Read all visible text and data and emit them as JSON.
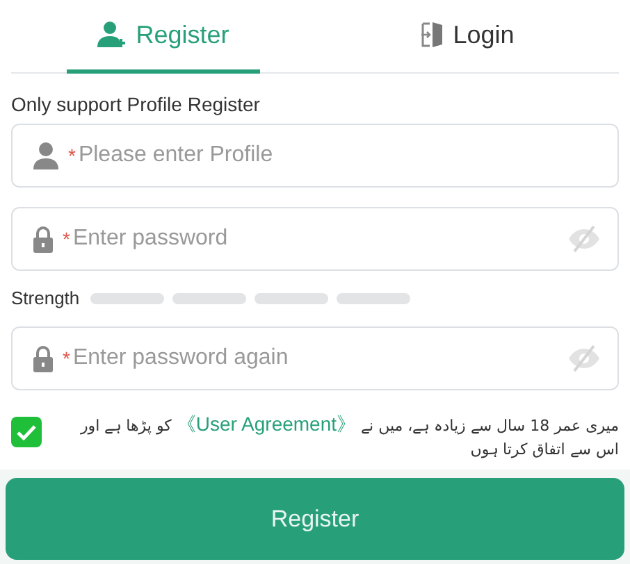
{
  "tabs": [
    {
      "label": "Register",
      "selected": true
    },
    {
      "label": "Login",
      "selected": false
    }
  ],
  "hint": "Only support Profile Register",
  "fields": [
    {
      "kind": "text",
      "required_mark": "*",
      "placeholder": "Please enter Profile"
    },
    {
      "kind": "password",
      "required_mark": "*",
      "placeholder": "Enter password"
    },
    {
      "kind": "password",
      "required_mark": "*",
      "placeholder": "Enter password again"
    }
  ],
  "strength": {
    "label": "Strength",
    "segments": [
      {
        "filled": false
      },
      {
        "filled": false
      },
      {
        "filled": false
      },
      {
        "filled": false
      }
    ]
  },
  "agreement": {
    "checked": true,
    "text_before": "میری عمر 18 سال سے زیادہ ہے، میں نے",
    "link": "《User Agreement》",
    "text_after": "کو پڑھا ہے اور اس سے اتفاق کرتا ہوں"
  },
  "submit": "Register"
}
